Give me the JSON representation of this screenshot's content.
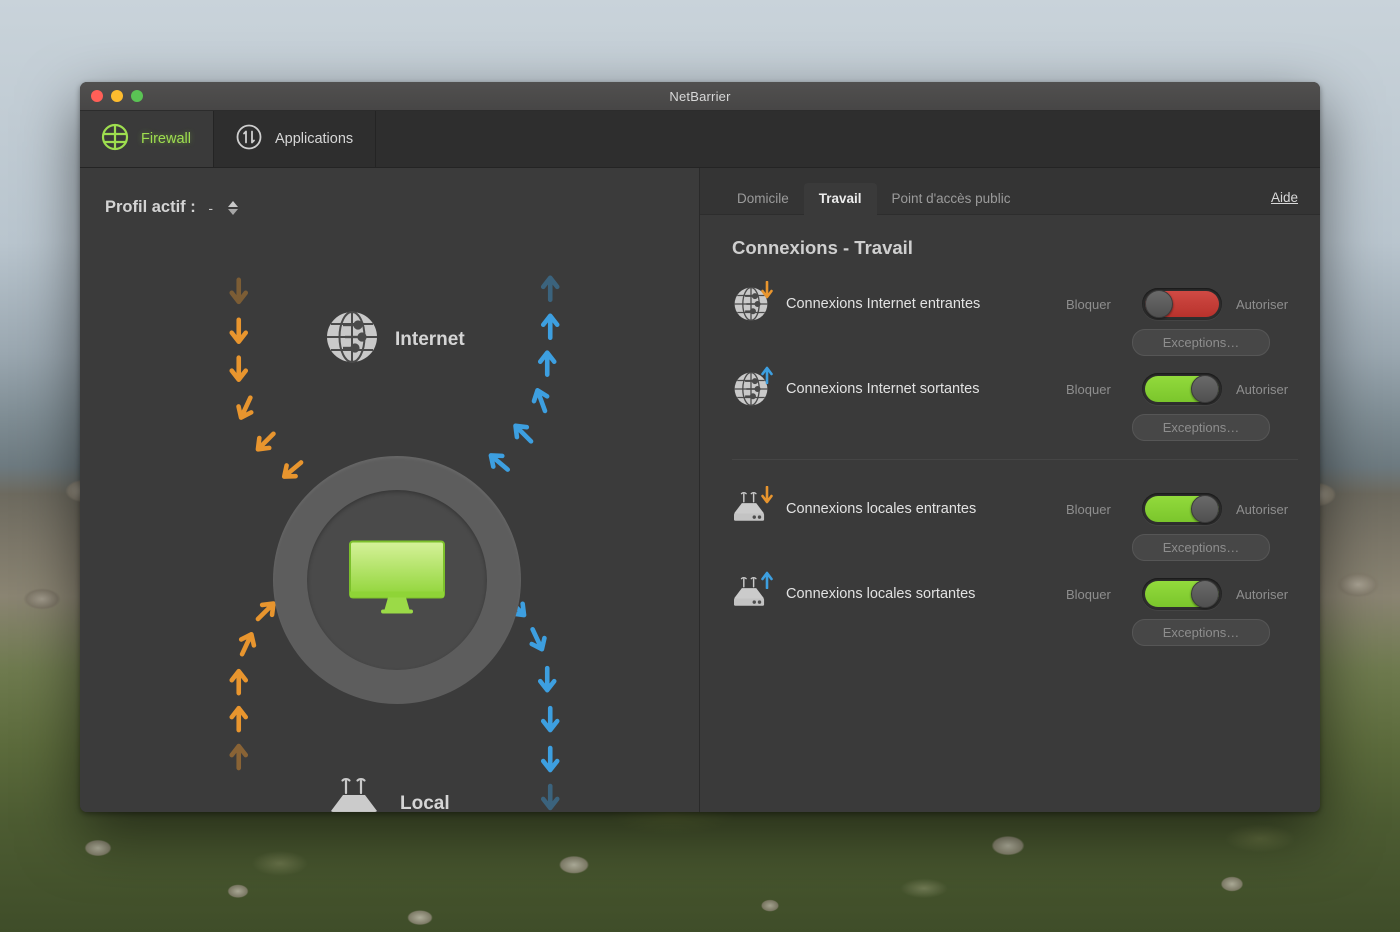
{
  "window": {
    "title": "NetBarrier",
    "traffic_lights": [
      "close",
      "minimize",
      "maximize"
    ]
  },
  "toolbar": {
    "tabs": [
      {
        "label": "Firewall",
        "icon": "firewall-icon",
        "selected": true
      },
      {
        "label": "Applications",
        "icon": "applications-icon",
        "selected": false
      }
    ]
  },
  "left_pane": {
    "profile_label": "Profil actif :",
    "profile_value": "-",
    "diagram": {
      "internet_label": "Internet",
      "local_label": "Local",
      "center_icon": "mac-computer-icon",
      "inbound_color": "#e8952e",
      "outbound_color": "#3d9fe0"
    }
  },
  "right_pane": {
    "tabs": [
      {
        "label": "Domicile",
        "active": false
      },
      {
        "label": "Travail",
        "active": true
      },
      {
        "label": "Point d'accès public",
        "active": false
      }
    ],
    "help_label": "Aide",
    "title": "Connexions - Travail",
    "block_label": "Bloquer",
    "allow_label": "Autoriser",
    "exceptions_label": "Exceptions…",
    "rows": [
      {
        "name": "Connexions Internet entrantes",
        "icon": "globe-icon",
        "direction": "inbound",
        "state": "blocked",
        "state_color": "#c23b34"
      },
      {
        "name": "Connexions Internet sortantes",
        "icon": "globe-icon",
        "direction": "outbound",
        "state": "allowed",
        "state_color": "#85cf32"
      },
      {
        "name": "Connexions locales entrantes",
        "icon": "router-icon",
        "direction": "inbound",
        "state": "allowed",
        "state_color": "#85cf32"
      },
      {
        "name": "Connexions locales sortantes",
        "icon": "router-icon",
        "direction": "outbound",
        "state": "allowed",
        "state_color": "#85cf32"
      }
    ]
  }
}
